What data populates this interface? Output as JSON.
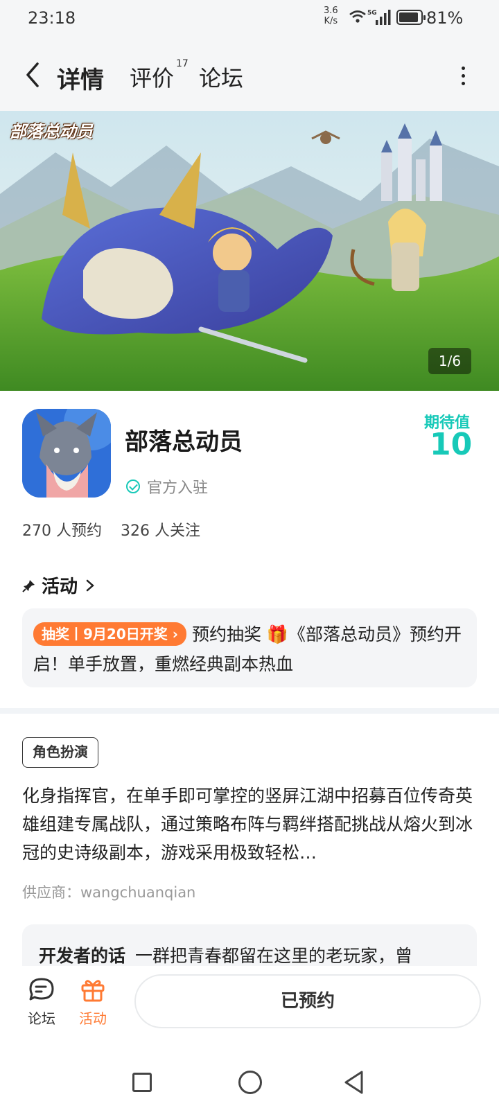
{
  "status": {
    "time": "23:18",
    "net_speed_top": "3.6",
    "net_speed_bottom": "K/s",
    "signal_label": "5G",
    "battery": "81%"
  },
  "header": {
    "tabs": [
      {
        "label": "详情"
      },
      {
        "label": "评价"
      },
      {
        "label": "论坛"
      }
    ],
    "review_count": "17"
  },
  "banner": {
    "logo_text": "部落总动员",
    "counter": "1/6"
  },
  "app": {
    "name": "部落总动员",
    "official": "官方入驻",
    "expect_label": "期待值",
    "expect_value": "10",
    "reservations": "270 人预约",
    "followers": "326 人关注"
  },
  "activity": {
    "title": "活动",
    "tag": "抽奖丨9月20日开奖",
    "text": "预约抽奖 🎁《部落总动员》预约开启！单手放置，重燃经典副本热血"
  },
  "detail": {
    "genre": "角色扮演",
    "description": "化身指挥官，在单手即可掌控的竖屏江湖中招募百位传奇英雄组建专属战队，通过策略布阵与羁绊搭配挑战从熔火到冰冠的史诗级副本，游戏采用极致轻松…",
    "supplier": "供应商：wangchuanqian",
    "dev_title": "开发者的话",
    "dev_text": "一群把青春都留在这里的老玩家，曾"
  },
  "bottom": {
    "forum": "论坛",
    "activity": "活动",
    "reserved": "已预约"
  },
  "colors": {
    "accent": "#17c9b8",
    "orange": "#ff7a33"
  }
}
